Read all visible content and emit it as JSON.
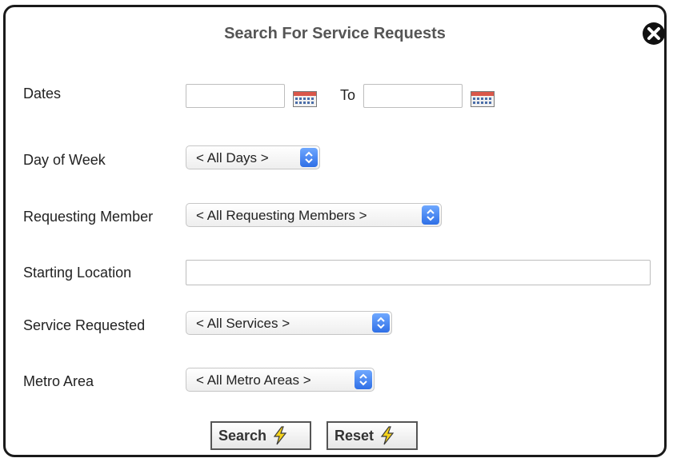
{
  "dialog": {
    "title": "Search For Service Requests"
  },
  "fields": {
    "dates": {
      "label": "Dates",
      "from_value": "",
      "to_label": "To",
      "to_value": ""
    },
    "day_of_week": {
      "label": "Day of Week",
      "selected": "< All Days >"
    },
    "requesting_member": {
      "label": "Requesting Member",
      "selected": "< All Requesting Members >"
    },
    "starting_location": {
      "label": "Starting Location",
      "value": ""
    },
    "service_requested": {
      "label": "Service Requested",
      "selected": "< All Services >"
    },
    "metro_area": {
      "label": "Metro Area",
      "selected": "< All Metro Areas >"
    }
  },
  "buttons": {
    "search": "Search",
    "reset": "Reset"
  },
  "icons": {
    "close": "close-icon",
    "calendar": "calendar-icon",
    "bolt": "lightning-bolt-icon",
    "stepper": "select-stepper-icon"
  },
  "colors": {
    "accent_blue": "#2f6fe6",
    "bolt_yellow": "#f5d31c"
  }
}
